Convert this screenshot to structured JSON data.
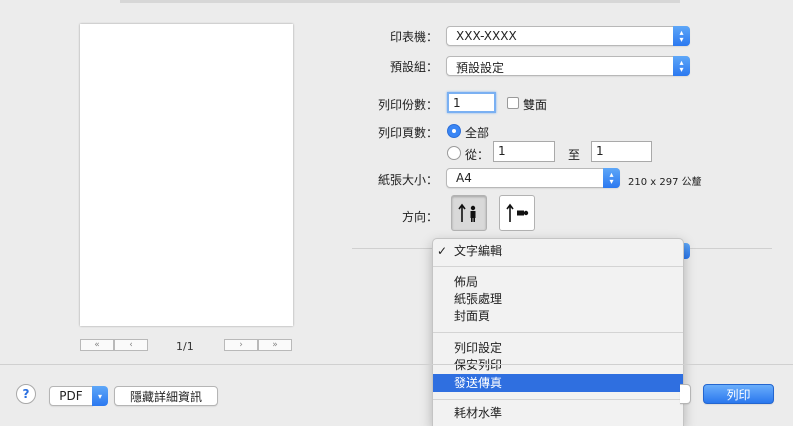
{
  "preview": {
    "page_label": "1/1"
  },
  "printer": {
    "label": "印表機：",
    "value": "XXX-XXXX"
  },
  "presets": {
    "label": "預設組：",
    "value": "預設設定"
  },
  "copies": {
    "label": "列印份數：",
    "value": "1",
    "duplex_label": "雙面"
  },
  "pages": {
    "label": "列印頁數：",
    "all_label": "全部",
    "from_label": "從：",
    "from_value": "1",
    "to_label": "至",
    "to_value": "1"
  },
  "paper": {
    "label": "紙張大小：",
    "value": "A4",
    "dimensions": "210 x 297 公釐"
  },
  "orientation": {
    "label": "方向："
  },
  "menu": {
    "items": [
      {
        "label": "文字編輯",
        "checked": true
      },
      {
        "label": "佈局"
      },
      {
        "label": "紙張處理"
      },
      {
        "label": "封面頁"
      },
      {
        "label": "列印設定"
      },
      {
        "label": "保安列印"
      },
      {
        "label": "發送傳真",
        "highlighted": true
      },
      {
        "label": "耗材水準"
      }
    ]
  },
  "footer": {
    "help_label": "?",
    "pdf_label": "PDF",
    "hide_details_label": "隱藏詳細資訊",
    "print_label": "列印"
  }
}
